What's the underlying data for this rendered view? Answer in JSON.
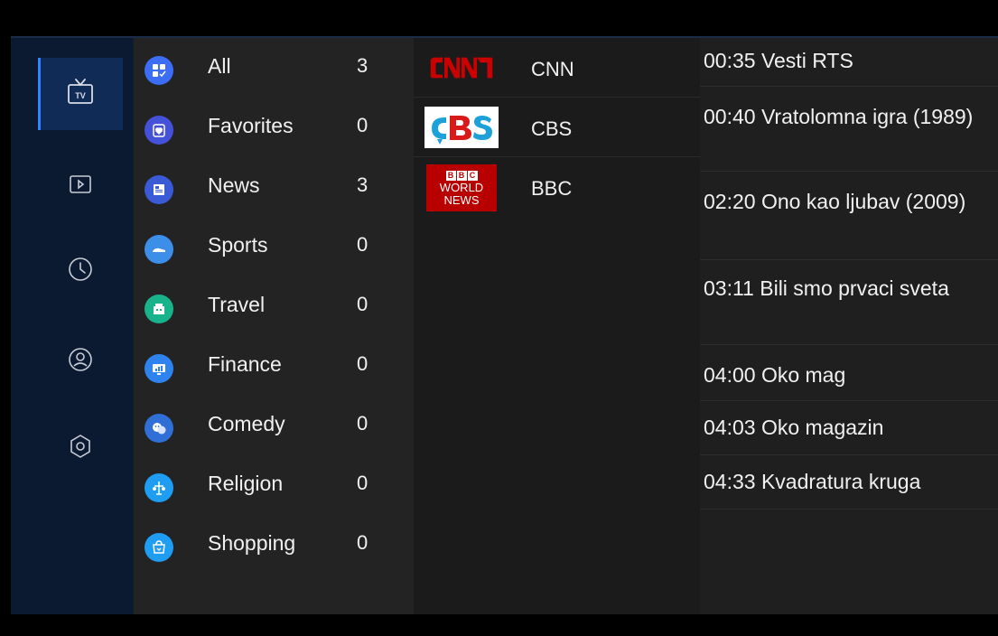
{
  "nav": {
    "items": [
      {
        "name": "tv",
        "icon": "tv-icon",
        "label": "TV",
        "active": true
      },
      {
        "name": "video",
        "icon": "play-icon",
        "active": false
      },
      {
        "name": "history",
        "icon": "clock-icon",
        "active": false
      },
      {
        "name": "account",
        "icon": "user-icon",
        "active": false
      },
      {
        "name": "settings",
        "icon": "settings-icon",
        "active": false
      }
    ]
  },
  "categories": [
    {
      "label": "All",
      "count": "3",
      "icon": "all-icon",
      "color": "#3b6df6"
    },
    {
      "label": "Favorites",
      "count": "0",
      "icon": "favorites-icon",
      "color": "#4551d9"
    },
    {
      "label": "News",
      "count": "3",
      "icon": "news-icon",
      "color": "#3a5ad6"
    },
    {
      "label": "Sports",
      "count": "0",
      "icon": "sports-icon",
      "color": "#3d8ee8"
    },
    {
      "label": "Travel",
      "count": "0",
      "icon": "travel-icon",
      "color": "#18b38a"
    },
    {
      "label": "Finance",
      "count": "0",
      "icon": "finance-icon",
      "color": "#2f83ef"
    },
    {
      "label": "Comedy",
      "count": "0",
      "icon": "comedy-icon",
      "color": "#2f6fd6"
    },
    {
      "label": "Religion",
      "count": "0",
      "icon": "religion-icon",
      "color": "#1e9df2"
    },
    {
      "label": "Shopping",
      "count": "0",
      "icon": "shopping-icon",
      "color": "#1e9df2"
    }
  ],
  "channels": [
    {
      "name": "CNN",
      "logo": "cnn-logo"
    },
    {
      "name": "CBS",
      "logo": "cbs-logo"
    },
    {
      "name": "BBC",
      "logo": "bbc-world-news-logo",
      "logo_text": [
        "BBC",
        "WORLD",
        "NEWS"
      ]
    }
  ],
  "programs": [
    {
      "text": "00:35 Vesti RTS"
    },
    {
      "text": "00:40 Vratolomna igra (1989)"
    },
    {
      "text": "02:20 Ono kao ljubav (2009)"
    },
    {
      "text": "03:11 Bili smo prvaci sveta"
    },
    {
      "text": "04:00 Oko mag"
    },
    {
      "text": "04:03 Oko magazin"
    },
    {
      "text": "04:33 Kvadratura kruga"
    }
  ],
  "colors": {
    "nav_bg": "#0c1a31",
    "nav_active": "#102b55",
    "accent": "#2f86ff",
    "category_bg": "#232323",
    "channel_bg": "#1b1b1b",
    "program_bg": "#1f1f1f",
    "cnn_red": "#cc0000",
    "cbs_blue": "#1da1d8",
    "bbc_red": "#b80000"
  }
}
